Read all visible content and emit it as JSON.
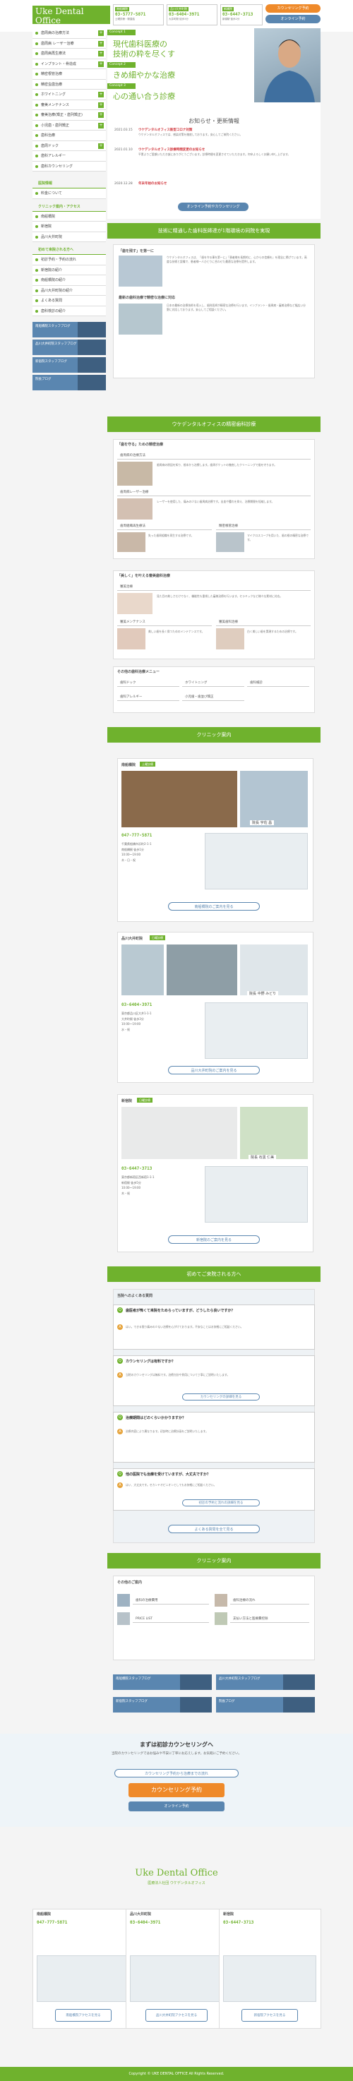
{
  "header": {
    "logo_title": "Uke Dental Office",
    "logo_sub": "医療法人社団 ウケデンタルオフィス",
    "clinics": [
      {
        "badge": "南船橋院",
        "phone": "03-5777-5871",
        "hours": "土曜診療・駅直結"
      },
      {
        "badge": "品川大井町院",
        "phone": "03-6404-3971",
        "hours": "大井町駅 徒歩3分"
      },
      {
        "badge": "新橋院",
        "phone": "03-6447-3713",
        "hours": "新橋駅 徒歩2分"
      }
    ],
    "btn_counsel": "カウンセリング予約",
    "btn_online": "オンライン予約"
  },
  "hero": {
    "concept1_tag": "Concept 1",
    "concept1_line1": "現代歯科医療の",
    "concept1_line2": "技術の粋を尽くす",
    "concept2_tag": "Concept 2",
    "concept2_text": "きめ細やかな治療",
    "concept3_tag": "Concept 3",
    "concept3_text": "心の通い合う診療"
  },
  "sidebar": {
    "items": [
      "歯周病の治療方法",
      "歯周病 レーザー治療",
      "歯周病再生療法",
      "インプラント・骨造成",
      "精密根管治療",
      "精密虫歯治療",
      "ホワイトニング",
      "審美メンテナンス",
      "審美治療(矯正・歯列矯正)",
      "小児歯・歯列矯正",
      "歯科治療",
      "歯周ドック",
      "歯科アレルギー",
      "歯科カウンセリング"
    ],
    "head_info": "医院情報",
    "info_items": [
      "料金について"
    ],
    "head_access": "クリニック案内・アクセス",
    "access_items": [
      "南船橋院",
      "新宿院",
      "品川大井町院"
    ],
    "head_first": "初めて来院される方へ",
    "first_items": [
      "初診予約・予約の流れ",
      "新宿院の紹介",
      "南船橋院の紹介",
      "品川大井町院の紹介",
      "よくある質問",
      "歯科検診の紹介"
    ],
    "banners": [
      "南船橋院スタッフブログ",
      "品川大井町院スタッフブログ",
      "新宿院スタッフブログ",
      "院長ブログ"
    ]
  },
  "news": {
    "title": "お知らせ・更新情報",
    "items": [
      {
        "date": "2021.03.15",
        "title": "ウケデンタルオフィス新型コロナ対策",
        "text": "ウケデンタルオフィスでは、感染対策を徹底しております。安心してご来院ください。"
      },
      {
        "date": "2021.01.10",
        "title": "ウケデンタルオフィス診療時間変更のお知らせ",
        "text": "平素よりご愛顧いただき誠にありがとうございます。診療時間を変更させていただきます。何卒よろしくお願い申し上げます。"
      },
      {
        "date": "2020.12.28",
        "title": "年末年始のお知らせ",
        "text": ""
      }
    ],
    "more_btn": "オンライン予約やカウンセリング"
  },
  "intro": {
    "heading": "技術に精通した歯科医師達が1階環境の同院を実現",
    "block1_title": "「歯を残す」を第一に",
    "block1_text": "ウケデンタルオフィスは、「歯を守る事を第一に」「患者様を長期的に、心からの信頼を」を理念に掲げています。高度な技術と設備で、患者様一人ひとりに合わせた最適な治療を提供します。",
    "block2_title": "最新の歯科治療で精密な治療に対応",
    "block2_text": "日本の最新の治療技術を導入し、歯科医師が精密な治療を行います。インプラント・歯周病・審美治療など幅広い分野に対応しております。安心してご相談ください。"
  },
  "treatments": {
    "heading": "ウケデンタルオフィスの精密歯科診療",
    "group1_title": "「歯を守る」ための精密治療",
    "cards1": [
      {
        "title": "歯周病の治療方法",
        "text": "歯周病の原因を知り、根本から治療します。歯周ポケットの徹底したクリーニングで歯を守ります。"
      },
      {
        "title": "歯周病レーザー治療",
        "text": "レーザーを使用した、痛みの少ない歯周病治療です。出血や腫れを抑え、治療期間を短縮します。"
      },
      {
        "title": "歯周組織再生療法",
        "text": "失った歯周組織を再生する治療です。"
      },
      {
        "title": "精密根管治療",
        "text": "マイクロスコープを用いた、歯の根の精密な治療です。"
      }
    ],
    "group2_title": "「美しく」を叶える審美歯科治療",
    "cards2": [
      {
        "title": "審美治療",
        "text": "見た目の美しさだけでなく、機能性も重視した審美治療を行います。セラミックなど様々な素材に対応。"
      },
      {
        "title": "審美メンテナンス",
        "text": "美しい歯を長く保つためのメンテナンスです。"
      },
      {
        "title": "審美歯科治療",
        "text": "白く美しい歯を実現するための治療です。"
      }
    ],
    "menu_title": "その他の歯科治療メニュー",
    "menu_items": [
      "歯科ドック",
      "ホワイトニング",
      "歯科検診",
      "歯科アレルギー",
      "小児歯・歯並び矯正",
      ""
    ]
  },
  "clinics": {
    "heading": "クリニック案内",
    "list": [
      {
        "name": "南船橋院",
        "badge": "土曜診療",
        "doctor": "院長 宇佐 昌",
        "phone": "047-777-5871",
        "address": "千葉県船橋市浜町2-1-1",
        "station": "南船橋駅 徒歩1分",
        "hours": "10:00〜19:00",
        "closed": "木・日・祝",
        "btn": "南船橋院のご案内を見る"
      },
      {
        "name": "品川大井町院",
        "badge": "日曜診療",
        "doctor": "院長 中野 みどり",
        "phone": "03-6404-3971",
        "address": "東京都品川区大井1-1-1",
        "station": "大井町駅 徒歩3分",
        "hours": "10:00〜19:00",
        "closed": "水・祝",
        "btn": "品川大井町院のご案内を見る"
      },
      {
        "name": "新宿院",
        "badge": "日曜診療",
        "doctor": "院長 石黒 仁美",
        "phone": "03-6447-3713",
        "address": "東京都新宿区西新宿1-1-1",
        "station": "新宿駅 徒歩5分",
        "hours": "10:00〜19:00",
        "closed": "木・祝",
        "btn": "新宿院のご案内を見る"
      }
    ]
  },
  "faq": {
    "heading": "初めてご来院される方へ",
    "sub": "当院へのよくある質問",
    "items": [
      {
        "q": "歯医者が怖くて来院をためらっていますが、どうしたら良いですか？",
        "a": "はい。できる限り痛みの少ない治療を心がけております。不安なことはお気軽にご相談ください。"
      },
      {
        "q": "カウンセリングは有料ですか？",
        "a": "当院のカウンセリングは無料です。治療方針や費用について丁寧にご説明いたします。"
      },
      {
        "q": "治療期間はどのくらいかかりますか？",
        "a": "治療内容により異なります。初診時に治療計画をご説明いたします。"
      },
      {
        "q": "他の医院でも治療を受けていますが、大丈夫ですか？",
        "a": "はい、大丈夫です。セカンドオピニオンとしてもお気軽にご相談ください。"
      }
    ],
    "btn_detail": "カウンセリングの詳細を見る",
    "btn_more": "初診の予約と流れの詳細を見る",
    "btn_all": "よくある質問を全て見る"
  },
  "clinic_info": {
    "heading": "クリニック案内",
    "sub": "その他のご案内",
    "items": [
      "歯科の治療費用",
      "歯科治療の流れ",
      "PRICE LIST",
      "支払い方法と医療費控除"
    ],
    "banners": [
      "南船橋院スタッフブログ",
      "品川大井町院スタッフブログ",
      "新宿院スタッフブログ",
      "院長ブログ"
    ]
  },
  "cta": {
    "title": "まずは初診カウンセリングへ",
    "text": "当院のカウンセリングではお悩みや不安に丁寧にお応えします。お気軽にご予約ください。",
    "btn_flow": "カウンセリング予約から治療までの流れ",
    "btn_counsel": "カウンセリング予約",
    "btn_online": "オンライン予約"
  },
  "footer": {
    "logo": "Uke Dental Office",
    "logo_sub": "医療法人社団 ウケデンタルオフィス",
    "clinics": [
      {
        "name": "南船橋院",
        "phone": "047-777-5871",
        "btn": "南船橋院アクセスを見る"
      },
      {
        "name": "品川大井町院",
        "phone": "03-6404-3971",
        "btn": "品川大井町院アクセスを見る"
      },
      {
        "name": "新宿院",
        "phone": "03-6447-3713",
        "btn": "新宿院アクセスを見る"
      }
    ],
    "copyright": "Copyright © UKE DENTAL OFFICE All Rights Reserved."
  }
}
